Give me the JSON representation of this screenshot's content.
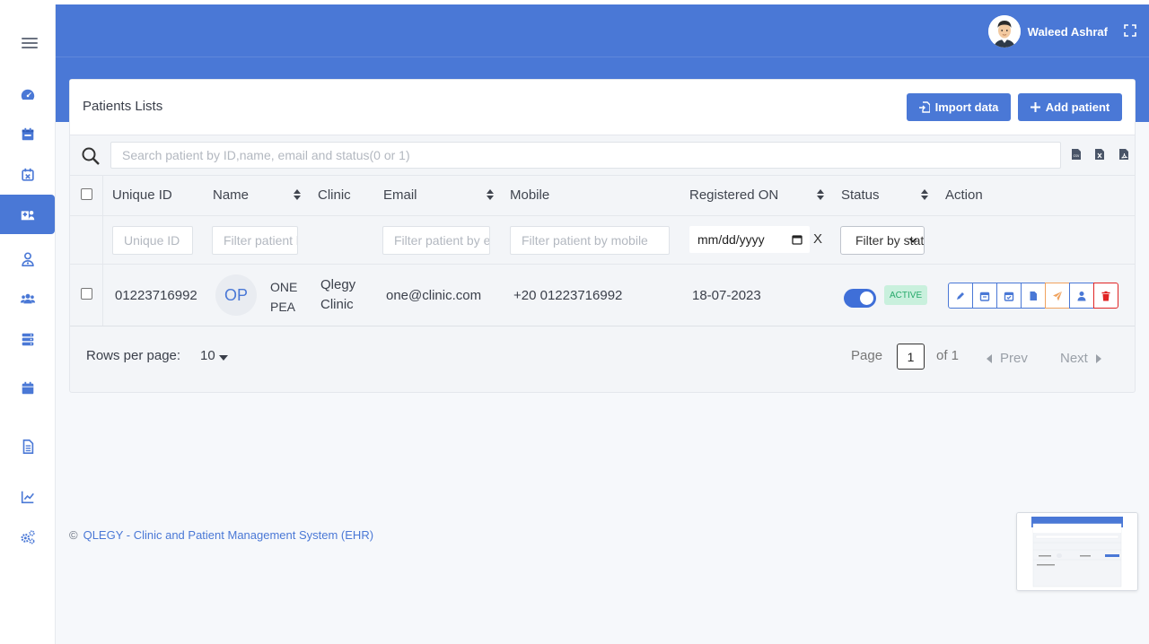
{
  "user": {
    "name": "Waleed Ashraf"
  },
  "card": {
    "title": "Patients Lists",
    "import_label": "Import data",
    "add_label": "Add patient"
  },
  "search": {
    "placeholder": "Search patient by ID,name, email and status(0 or 1)"
  },
  "table": {
    "headers": {
      "unique_id": "Unique ID",
      "name": "Name",
      "clinic": "Clinic",
      "email": "Email",
      "mobile": "Mobile",
      "registered_on": "Registered ON",
      "status": "Status",
      "action": "Action"
    },
    "filters": {
      "unique_id": "Unique ID",
      "name": "Filter patient by name",
      "email": "Filter patient by email",
      "mobile": "Filter patient by mobile",
      "date": "mm/dd/yyyy",
      "date_clear": "X",
      "status": "Filter by status"
    },
    "rows": [
      {
        "unique_id": "01223716992",
        "initials": "OP",
        "name_line1": "ONE",
        "name_line2": "PEA",
        "clinic_line1": "Qlegy",
        "clinic_line2": "Clinic",
        "email": "one@clinic.com",
        "mobile": "+20 01223716992",
        "registered_on": "18-07-2023",
        "status_badge": "ACTIVE",
        "status_on": true
      }
    ]
  },
  "pagination": {
    "rows_per_page_label": "Rows per page:",
    "rows_per_page": "10",
    "page_label": "Page",
    "page": "1",
    "of_label": "of 1",
    "prev": "Prev",
    "next": "Next"
  },
  "footer": {
    "copyright": "©",
    "text": "QLEGY - Clinic and Patient Management System (EHR)"
  },
  "colors": {
    "primary": "#4a78d6",
    "active_badge_bg": "#c9f0dd",
    "active_badge_text": "#27a96b",
    "danger": "#e02424",
    "warning": "#f0a35e"
  }
}
